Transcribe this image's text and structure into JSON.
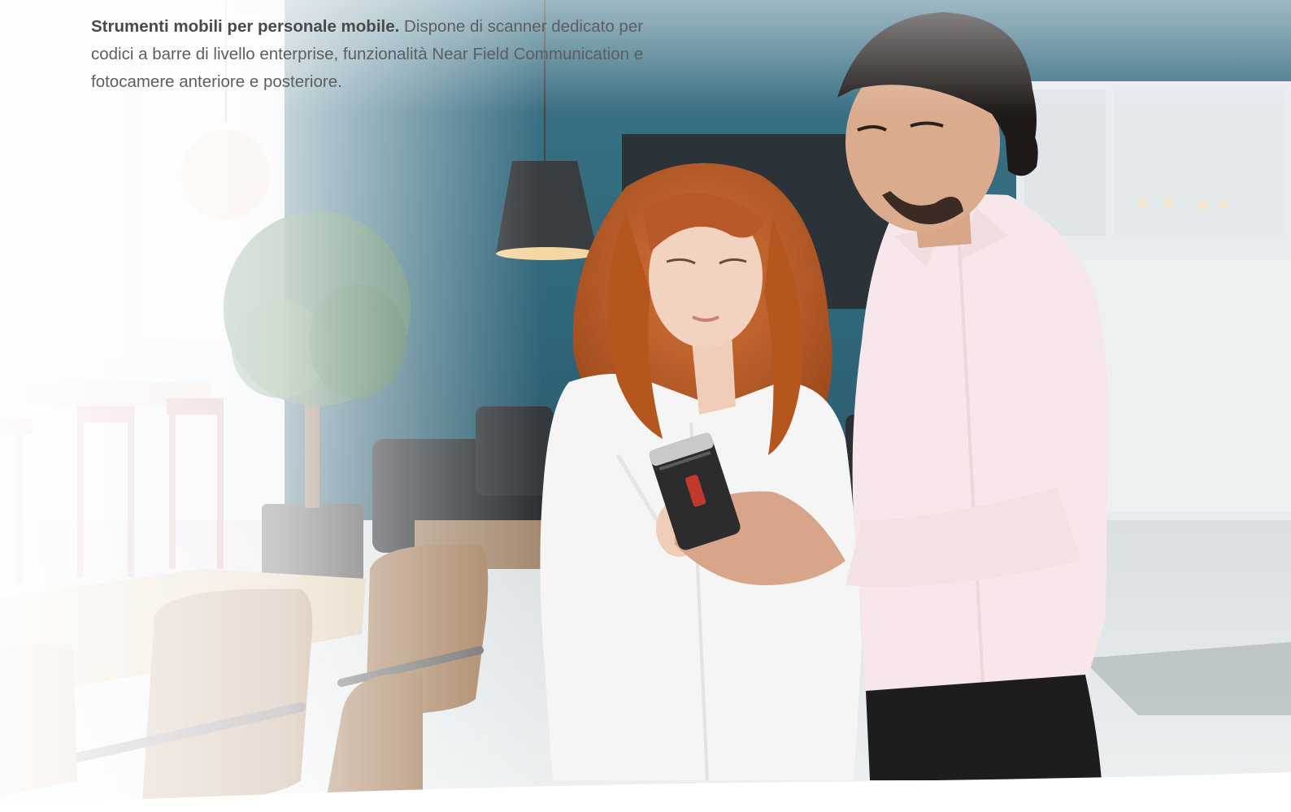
{
  "hero": {
    "headline_bold": "Strumenti mobili per personale mobile.",
    "body_text": "Dispone di scanner dedicato per codici a barre di livello enterprise, funzionalità Near Field Communication e fotocamere anteriore e posteriore.",
    "image_icon": "photo-people-with-handheld-device"
  },
  "colors": {
    "wall_teal": "#3d7186",
    "text_gray": "#5e5e5e",
    "device_accent": "#c0392b"
  }
}
